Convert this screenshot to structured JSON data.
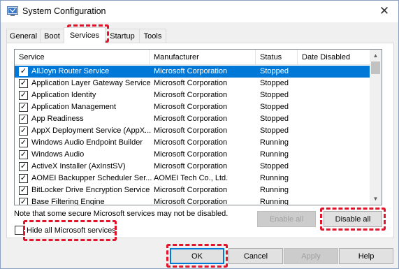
{
  "window": {
    "title": "System Configuration",
    "close_glyph": "✕",
    "app_icon": "system-configuration-icon"
  },
  "tabs": [
    {
      "label": "General",
      "active": false
    },
    {
      "label": "Boot",
      "active": false
    },
    {
      "label": "Services",
      "active": true
    },
    {
      "label": "Startup",
      "active": false
    },
    {
      "label": "Tools",
      "active": false
    }
  ],
  "services": {
    "columns": [
      "Service",
      "Manufacturer",
      "Status",
      "Date Disabled"
    ],
    "rows": [
      {
        "name": "AllJoyn Router Service",
        "manufacturer": "Microsoft Corporation",
        "status": "Stopped",
        "date": "",
        "checked": true,
        "selected": true
      },
      {
        "name": "Application Layer Gateway Service",
        "manufacturer": "Microsoft Corporation",
        "status": "Stopped",
        "date": "",
        "checked": true,
        "selected": false
      },
      {
        "name": "Application Identity",
        "manufacturer": "Microsoft Corporation",
        "status": "Stopped",
        "date": "",
        "checked": true,
        "selected": false
      },
      {
        "name": "Application Management",
        "manufacturer": "Microsoft Corporation",
        "status": "Stopped",
        "date": "",
        "checked": true,
        "selected": false
      },
      {
        "name": "App Readiness",
        "manufacturer": "Microsoft Corporation",
        "status": "Stopped",
        "date": "",
        "checked": true,
        "selected": false
      },
      {
        "name": "AppX Deployment Service (AppX...",
        "manufacturer": "Microsoft Corporation",
        "status": "Stopped",
        "date": "",
        "checked": true,
        "selected": false
      },
      {
        "name": "Windows Audio Endpoint Builder",
        "manufacturer": "Microsoft Corporation",
        "status": "Running",
        "date": "",
        "checked": true,
        "selected": false
      },
      {
        "name": "Windows Audio",
        "manufacturer": "Microsoft Corporation",
        "status": "Running",
        "date": "",
        "checked": true,
        "selected": false
      },
      {
        "name": "ActiveX Installer (AxInstSV)",
        "manufacturer": "Microsoft Corporation",
        "status": "Stopped",
        "date": "",
        "checked": true,
        "selected": false
      },
      {
        "name": "AOMEI Backupper Scheduler Ser...",
        "manufacturer": "AOMEI Tech Co., Ltd.",
        "status": "Running",
        "date": "",
        "checked": true,
        "selected": false
      },
      {
        "name": "BitLocker Drive Encryption Service",
        "manufacturer": "Microsoft Corporation",
        "status": "Running",
        "date": "",
        "checked": true,
        "selected": false
      },
      {
        "name": "Base Filtering Engine",
        "manufacturer": "Microsoft Corporation",
        "status": "Running",
        "date": "",
        "checked": true,
        "selected": false
      }
    ]
  },
  "note": "Note that some secure Microsoft services may not be disabled.",
  "buttons": {
    "enable_all": "Enable all",
    "disable_all": "Disable all",
    "ok": "OK",
    "cancel": "Cancel",
    "apply": "Apply",
    "help": "Help"
  },
  "hide_ms": {
    "label": "Hide all Microsoft services",
    "checked": false
  },
  "check_glyph": "✓",
  "scroll": {
    "up": "▲",
    "down": "▼"
  },
  "colors": {
    "selection": "#0078d7",
    "highlight": "#e0142b"
  }
}
